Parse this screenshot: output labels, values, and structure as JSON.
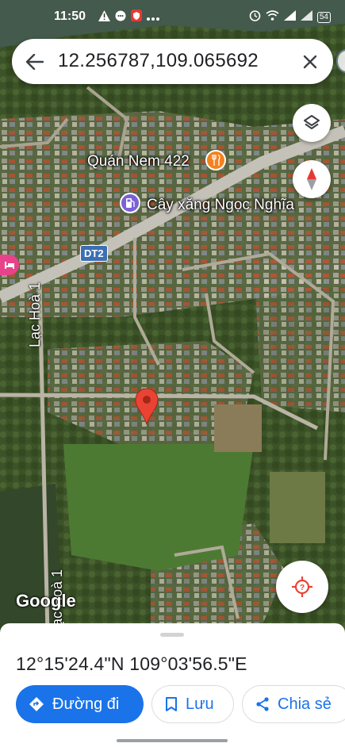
{
  "status_bar": {
    "time": "11:50",
    "battery": "54"
  },
  "search": {
    "query": "12.256787,109.065692"
  },
  "map": {
    "labels": {
      "restaurant": "Quán Nem 422",
      "gas_station": "Cây xăng Ngọc Nghĩa",
      "road_shield": "DT2",
      "street_1": "Lạc Hoà 1",
      "street_2": "Lạc Hoà 1",
      "attribution": "Google"
    },
    "icons": [
      "layers-icon",
      "compass-icon",
      "my-location-icon",
      "restaurant-icon",
      "gas-station-icon",
      "hotel-icon",
      "location-pin-icon"
    ],
    "colors": {
      "pin": "#ea4335",
      "restaurant": "#f4811f",
      "gas_station": "#7b61d6",
      "hotel": "#e8428b",
      "road_shield": "#3c6fb4"
    }
  },
  "sheet": {
    "coordinates": "12°15'24.4\"N 109°03'56.5\"E",
    "actions": {
      "directions": "Đường đi",
      "save": "Lưu",
      "share": "Chia sẻ"
    },
    "accent": "#1a73e8"
  }
}
